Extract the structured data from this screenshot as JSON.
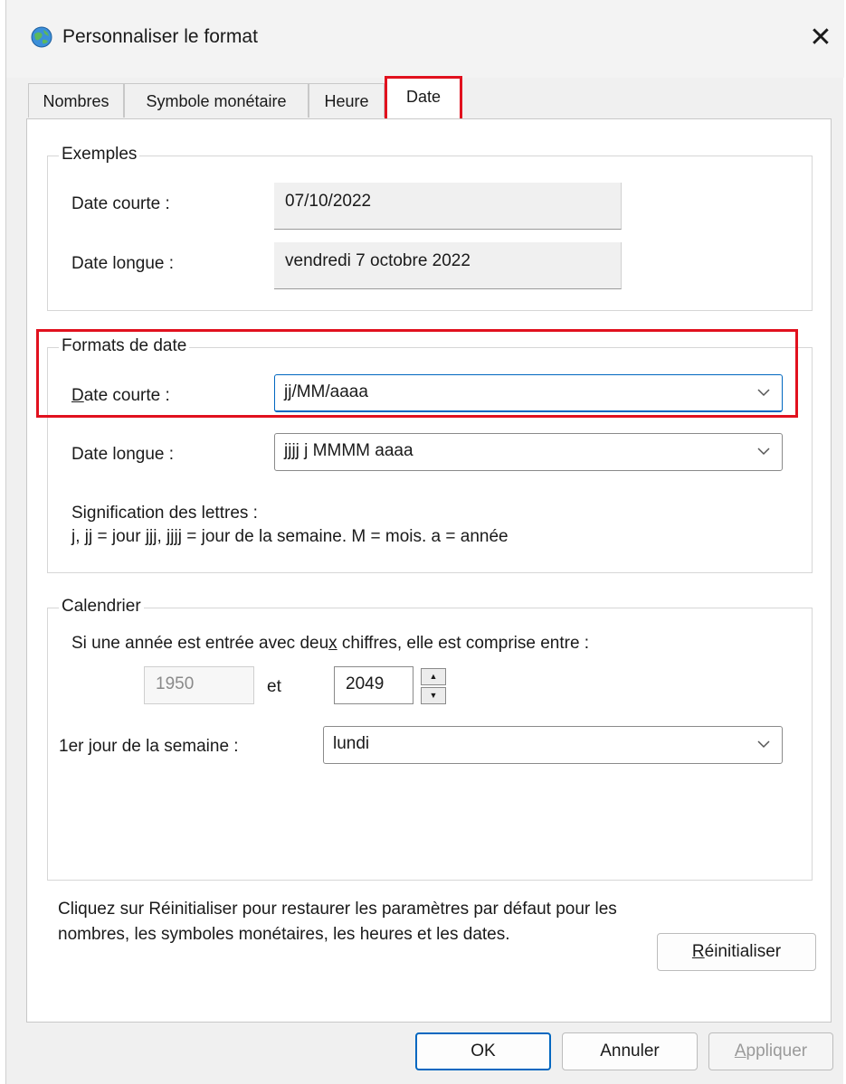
{
  "window": {
    "title": "Personnaliser le format",
    "close_glyph": "✕"
  },
  "tabs": [
    {
      "label": "Nombres"
    },
    {
      "label": "Symbole monétaire"
    },
    {
      "label": "Heure"
    },
    {
      "label": "Date"
    }
  ],
  "examples": {
    "legend": "Exemples",
    "short_label": "Date courte :",
    "short_value": "07/10/2022",
    "long_label": "Date longue :",
    "long_value": "vendredi 7 octobre 2022"
  },
  "formats": {
    "legend": "Formats de date",
    "short_label_u": "D",
    "short_label_rest": "ate courte :",
    "short_value": "jj/MM/aaaa",
    "long_label_a": "Date lon",
    "long_label_u": "g",
    "long_label_b": "ue :",
    "long_value": "jjjj j MMMM aaaa",
    "meaning_title": "Signification des lettres :",
    "meaning_text": "j, jj = jour  jjj, jjjj = jour de la semaine. M = mois. a = année"
  },
  "calendar": {
    "legend": "Calendrier",
    "two_digit_a": "Si une année est entrée avec deu",
    "two_digit_u": "x",
    "two_digit_b": " chiffres, elle est comprise entre :",
    "from_year": "1950",
    "and_label": "et",
    "to_year": "2049",
    "first_day_a": "1er ",
    "first_day_u": "j",
    "first_day_b": "our de la semaine :",
    "first_day_value": "lundi"
  },
  "reset": {
    "description": "Cliquez sur Réinitialiser pour restaurer les paramètres par défaut pour les nombres, les symboles monétaires, les heures et les dates.",
    "button_u": "R",
    "button_rest": "éinitialiser"
  },
  "footer": {
    "ok": "OK",
    "cancel": "Annuler",
    "apply_u": "A",
    "apply_rest": "ppliquer"
  },
  "colors": {
    "highlight": "#e1111e",
    "focus": "#0067c0"
  }
}
